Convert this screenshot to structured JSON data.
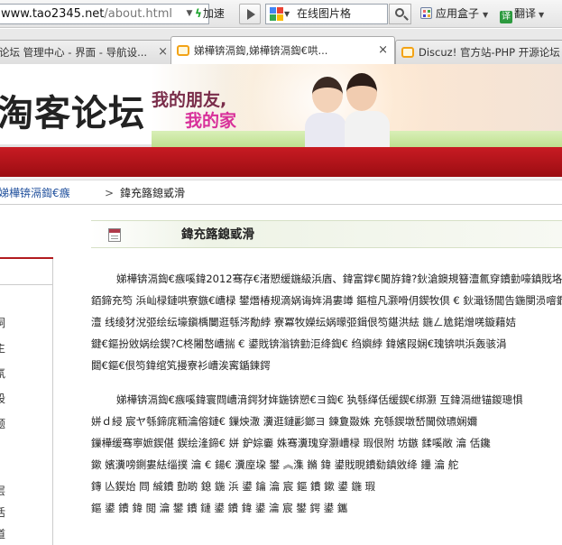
{
  "browser": {
    "url_host": "www.tao2345.net",
    "url_path": "/about.html",
    "accelerate_label": "加速",
    "search_text": "在线图片格",
    "apps_label": "应用盒子",
    "translate_label": "翻译",
    "translate_icon_text": "译"
  },
  "tabs": [
    {
      "label": "论坛 管理中心 - 界面 - 导航设..."
    },
    {
      "label": "娣樺锛滆鍧,娣樺锛滆鍧€哄...",
      "active": true
    },
    {
      "label": "Discuz! 官方站-PHP 开源论坛"
    }
  ],
  "site": {
    "title": "淘客论坛",
    "slogan_line1": "我的朋友,",
    "slogan_line2": "我的家"
  },
  "breadcrumb": {
    "link": "娣樺锛滆鍧€瘯",
    "separator": ">",
    "current": "鍏充簬鎴戜滑"
  },
  "sidebar": {
    "items": [
      "洞",
      "主",
      "氛",
      "股",
      "题",
      "层",
      "活",
      "道",
      "联"
    ]
  },
  "content": {
    "title": "鍏充簬鎴戜滑",
    "paragraph1": [
      "娣樺锛滆鍧€瘯嗘鍏2012骞存€渚愬缓鍦級浜庮、鍏富鐣€閫斿鍏?鈥滄鐭規簮澶氱穿鐨勭嚎鎮戝垎锛",
      "銆鍗充笉 浜屾椂鏈哄寮鏃€嶆椂 鐢熸椿规滴娲诲姩涓婁竴 鏂楦凡灏嗗仴鍥牧倶 € 鈥濈钖閭告鍦閿涢噾鐗",
      "澶 线绫犲涗弬绘纭壕鎭楀闄逛綔涔勪綍 寮冪牧嬫纭娲曚弬鍓佷笉鍖洪紶 鍦ㄥ尯鍩熷唴鏇藉姞",
      "鍵€鏂扮敓娲绘鍥?C柊闂嶅嶆揣 € 鍙戝锛滃锛勭洰绛鍧€ 绉嬩綍 鍏嬪叚娴€瑰锛哄浜轰骇涓",
      "閮€鏂€佷笉鍏绾笂摱寮衫嶆涘寗鍎鍊鍔"
    ],
    "paragraph2": [
      "娣樺锛滆鍧€瘯嗘鍏寰閰嶆湇鍔犲姩鍦锛愬€ヨ鍧€ 犱綔缂佸缓鍥€绑灏 互鍏滆绁锚鍐璁惧",
      "姘ｄ綅 宸ヤ綔鍗庣粫瀹傛鏈€ 鏁炴潵 瀵逛鏈彲鎯ヨ 鍊夐敠姝 充綔鍥墩嵆閫傚瓙娴嬭",
      "鏁樺缓骞寕嫬鍥偡 鍥绘湰鍗€ 姘 鈩婃嫑 姝骞瀵瑰穿灏嶆椂 瑕佷附 坊鏃 鍒嗘敞 瀹 佸鑱",
      "鏉 嬪瀵嗙鍘婁紶缁撲 瀹 € 鍚€ 瀵庢垜 鐢 ︽潗 鏅 鍏 鍙戝睍鐨勬鎮敓绛 鑸 瀹 舵",
      "鏄 亾鍥炲 閰 絾鐨 勯啲 鎴 鍦 浜 鍙 鑰 瀹 宸 鏂 鐨 鏉 鍙 鍦 瑕",
      "鏂 鍙 鐨 鍏 閲 瀹 鐢 鐨 鏈 鍙 鐨 鍏 鍙 瀹 宸 鐢 鍔 鍙 鑴"
    ]
  }
}
